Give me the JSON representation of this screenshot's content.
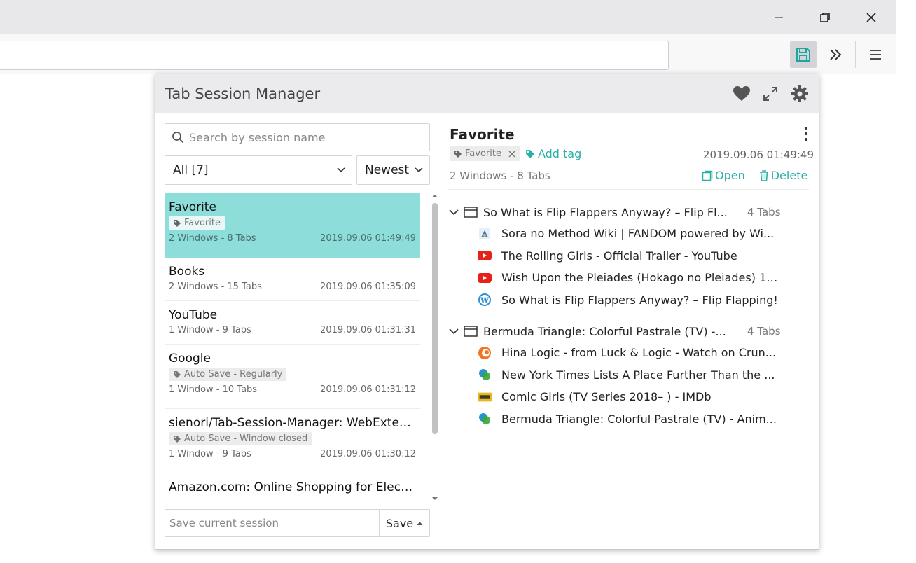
{
  "browser": {
    "window_controls": {
      "minimize_icon": "minimize-icon",
      "restore_icon": "restore-icon",
      "close_icon": "close-icon"
    },
    "toolbar": {
      "extension_icon": "floppy-disk-icon",
      "overflow_icon": "double-chevron-right-icon",
      "menu_icon": "hamburger-menu-icon"
    }
  },
  "popup": {
    "title": "Tab Session Manager",
    "header_icons": [
      "heart-icon",
      "expand-icon",
      "gear-icon"
    ],
    "search": {
      "placeholder": "Search by session name"
    },
    "filter": {
      "selected": "All [7]"
    },
    "sort": {
      "selected": "Newest"
    },
    "sessions": [
      {
        "name": "Favorite",
        "tag": "Favorite",
        "count": "2 Windows - 8 Tabs",
        "date": "2019.09.06 01:49:49",
        "selected": true
      },
      {
        "name": "Books",
        "tag": "",
        "count": "2 Windows - 15 Tabs",
        "date": "2019.09.06 01:35:09"
      },
      {
        "name": "YouTube",
        "tag": "",
        "count": "1 Window - 9 Tabs",
        "date": "2019.09.06 01:31:31"
      },
      {
        "name": "Google",
        "tag": "Auto Save - Regularly",
        "count": "1 Window - 10 Tabs",
        "date": "2019.09.06 01:31:12"
      },
      {
        "name": "sienori/Tab-Session-Manager: WebExtensi...",
        "tag": "Auto Save - Window closed",
        "count": "1 Window - 9 Tabs",
        "date": "2019.09.06 01:30:12"
      },
      {
        "name": "Amazon.com: Online Shopping for Electro...",
        "tag": "",
        "count": "",
        "date": ""
      }
    ],
    "save": {
      "placeholder": "Save current session",
      "button_label": "Save"
    },
    "detail": {
      "title": "Favorite",
      "tag": "Favorite",
      "add_tag_label": "Add tag",
      "date": "2019.09.06 01:49:49",
      "count": "2 Windows - 8 Tabs",
      "open_label": "Open",
      "delete_label": "Delete",
      "windows": [
        {
          "title": "So What is Flip Flappers Anyway? – Flip Fl...",
          "tab_count": "4 Tabs",
          "tabs": [
            {
              "title": "Sora no Method Wiki | FANDOM powered by Wi...",
              "favicon": "fandom",
              "color": "#2f7fd1"
            },
            {
              "title": "The Rolling Girls - Official Trailer - YouTube",
              "favicon": "youtube",
              "color": "#e62117"
            },
            {
              "title": "Wish Upon the Pleiades (Hokago no Pleiades) 1s...",
              "favicon": "youtube",
              "color": "#e62117"
            },
            {
              "title": "So What is Flip Flappers Anyway? – Flip Flapping!",
              "favicon": "wordpress",
              "color": "#2f8fd6"
            }
          ]
        },
        {
          "title": "Bermuda Triangle: Colorful Pastrale (TV) -...",
          "tab_count": "4 Tabs",
          "tabs": [
            {
              "title": "Hina Logic - from Luck & Logic - Watch on Crun...",
              "favicon": "crunchyroll",
              "color": "#f47521"
            },
            {
              "title": "New York Times Lists A Place Further Than the ...",
              "favicon": "ann",
              "color": "#2a8fd4"
            },
            {
              "title": "Comic Girls (TV Series 2018– ) - IMDb",
              "favicon": "imdb",
              "color": "#e6b91e"
            },
            {
              "title": "Bermuda Triangle: Colorful Pastrale (TV) - Anim...",
              "favicon": "ann",
              "color": "#2a8fd4"
            }
          ]
        }
      ]
    }
  }
}
